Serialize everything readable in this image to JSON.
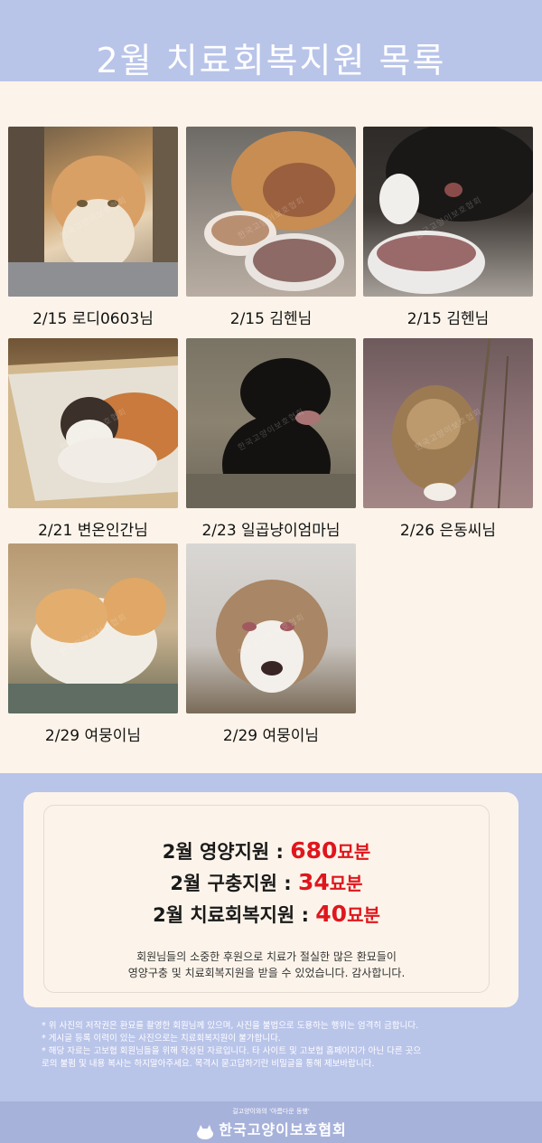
{
  "header": {
    "title": "2월 치료회복지원 목록"
  },
  "cases": [
    {
      "caption": "2/15 로디0603님",
      "bg": "#b08862"
    },
    {
      "caption": "2/15 김헨님",
      "bg": "#9b8f86"
    },
    {
      "caption": "2/15 김헨님",
      "bg": "#4a4540"
    },
    {
      "caption": "2/21 변온인간님",
      "bg": "#b59a76"
    },
    {
      "caption": "2/23 일곱냥이엄마님",
      "bg": "#5e574c"
    },
    {
      "caption": "2/26 은동씨님",
      "bg": "#8b7474"
    },
    {
      "caption": "2/29 여뭉이님",
      "bg": "#c4ab86"
    },
    {
      "caption": "2/29 여뭉이님",
      "bg": "#b7aba2"
    }
  ],
  "watermark": "한국고양이보호협회",
  "summary": {
    "nutrition": {
      "label": "2월 영양지원 : ",
      "value": "680",
      "unit": "묘분"
    },
    "deworm": {
      "label": "2월 구충지원 : ",
      "value": "34",
      "unit": "묘분"
    },
    "treatment": {
      "label": "2월 치료회복지원 : ",
      "value": "40",
      "unit": "묘분"
    },
    "thanks_line1": "회원님들의 소중한 후원으로 치료가 절실한 많은 환묘들이",
    "thanks_line2": "영양구충 및 치료회복지원을 받을 수 있었습니다. 감사합니다."
  },
  "notes": [
    "* 위 사진의 저작권은 환묘를 촬영한 회원님께 있으며, 사진을 불법으로 도용하는 행위는 엄격히 금합니다.",
    "* 게시글 등록 이력이 있는 사진으로는 치료회복지원이 불가합니다.",
    "* 해당 자료는 고보협 회원님들을 위해 작성된 자료입니다. 타 사이트 및 고보협 홈페이지가 아닌 다른 곳으",
    "   로의 불펌 및 내용 복사는 하지말아주세요.  목격시 묻고답하기란 비밀글을 통해 제보바랍니다."
  ],
  "footer": {
    "tagline": "길고양이와의  '아름다운 동행'",
    "org": "한국고양이보호협회"
  },
  "colors": {
    "accent_red": "#e0161d",
    "header_blue": "#b9c4e9",
    "panel_cream": "#fcf4ea"
  }
}
